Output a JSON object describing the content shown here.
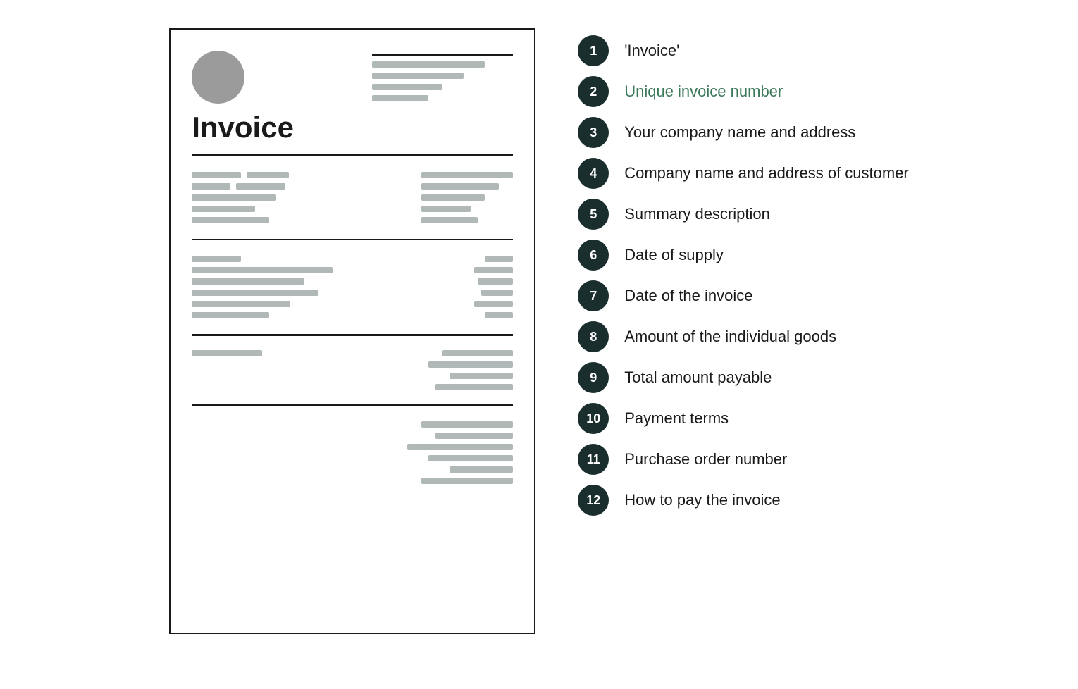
{
  "invoice": {
    "title": "Invoice",
    "header_lines": [
      {
        "width": 160
      },
      {
        "width": 130
      },
      {
        "width": 100
      },
      {
        "width": 80
      }
    ]
  },
  "legend": {
    "items": [
      {
        "number": "1",
        "text": "'Invoice'",
        "green": false
      },
      {
        "number": "2",
        "text": "Unique invoice number",
        "green": true
      },
      {
        "number": "3",
        "text": "Your company name and address",
        "green": false
      },
      {
        "number": "4",
        "text": "Company name and address of customer",
        "green": false
      },
      {
        "number": "5",
        "text": "Summary description",
        "green": false
      },
      {
        "number": "6",
        "text": "Date of supply",
        "green": false
      },
      {
        "number": "7",
        "text": "Date of the invoice",
        "green": false
      },
      {
        "number": "8",
        "text": "Amount of the individual goods",
        "green": false
      },
      {
        "number": "9",
        "text": "Total amount payable",
        "green": false
      },
      {
        "number": "10",
        "text": "Payment terms",
        "green": false
      },
      {
        "number": "11",
        "text": "Purchase order number",
        "green": false
      },
      {
        "number": "12",
        "text": "How to pay the invoice",
        "green": false
      }
    ]
  }
}
